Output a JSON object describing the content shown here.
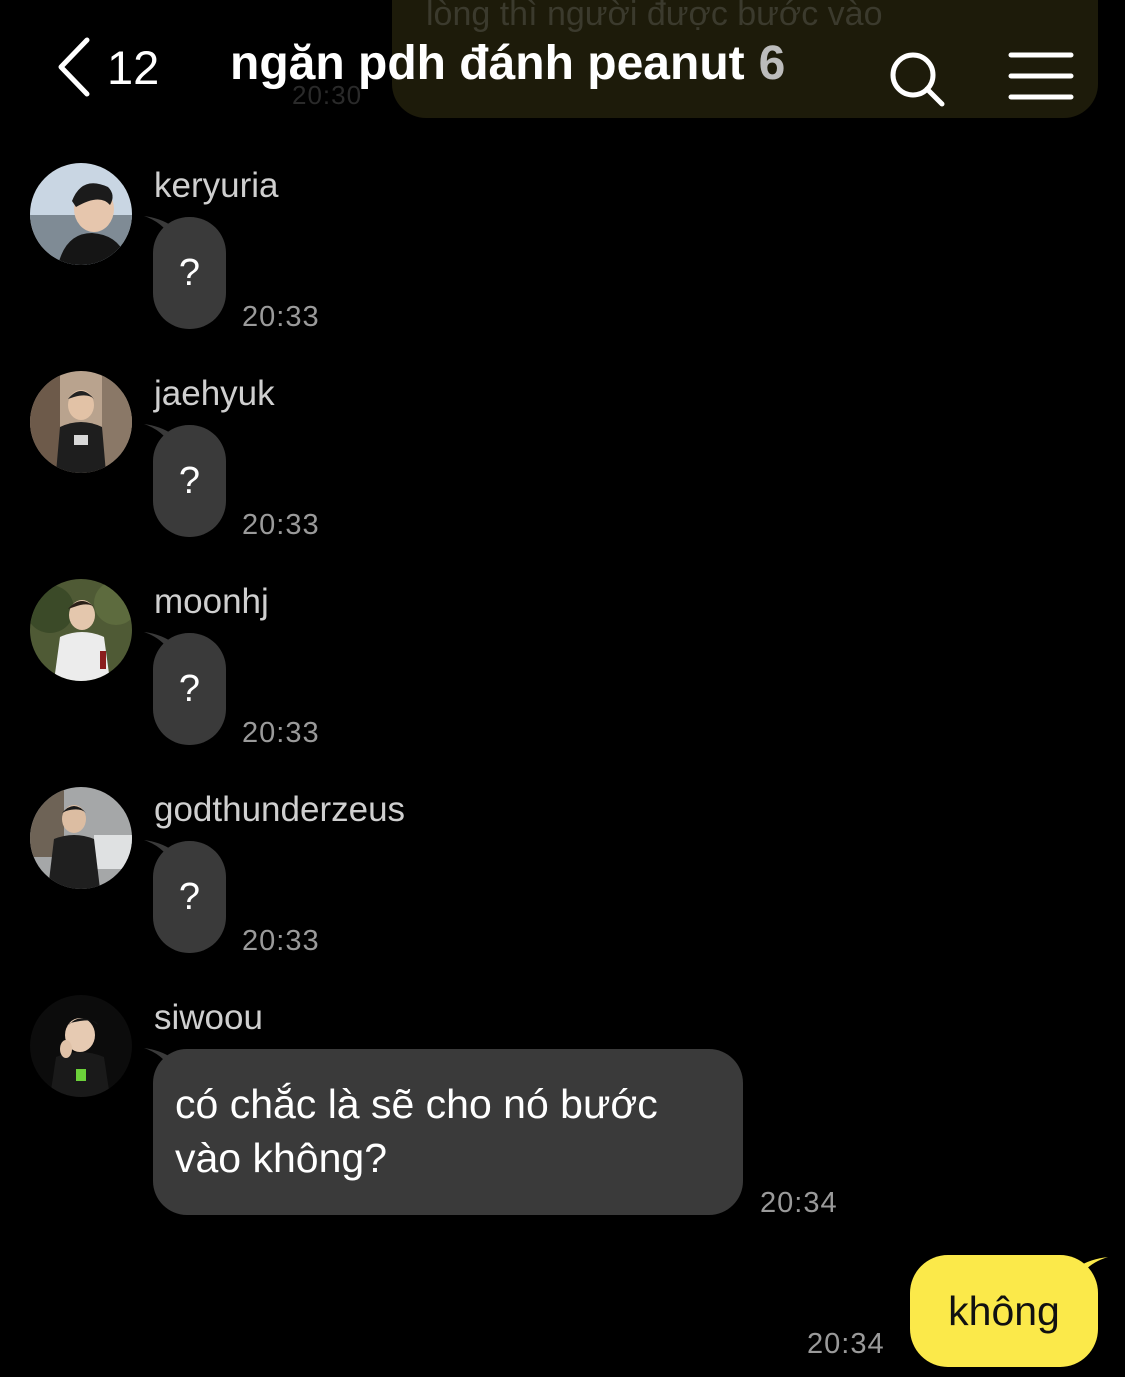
{
  "previous_message": {
    "text": "lòng thì người được bước vào",
    "time": "20:30"
  },
  "header": {
    "back_count": "12",
    "title": "ngăn pdh đánh peanut",
    "member_count": "6"
  },
  "messages": [
    {
      "sender": "keryuria",
      "text": "?",
      "time": "20:33"
    },
    {
      "sender": "jaehyuk",
      "text": "?",
      "time": "20:33"
    },
    {
      "sender": "moonhj",
      "text": "?",
      "time": "20:33"
    },
    {
      "sender": "godthunderzeus",
      "text": "?",
      "time": "20:33"
    },
    {
      "sender": "siwoou",
      "lines": [
        "có chắc là sẽ cho nó bước",
        "vào không?"
      ],
      "time": "20:34"
    }
  ],
  "my_message": {
    "text": "không",
    "time": "20:34"
  },
  "colors": {
    "background": "#000000",
    "incoming_bubble": "#3a3a3a",
    "outgoing_bubble": "#fbe94a",
    "timestamp": "#9a9a9a"
  },
  "icons": {
    "back": "chevron-left-icon",
    "search": "search-icon",
    "menu": "hamburger-menu-icon",
    "avatar": "user-avatar-photo"
  }
}
